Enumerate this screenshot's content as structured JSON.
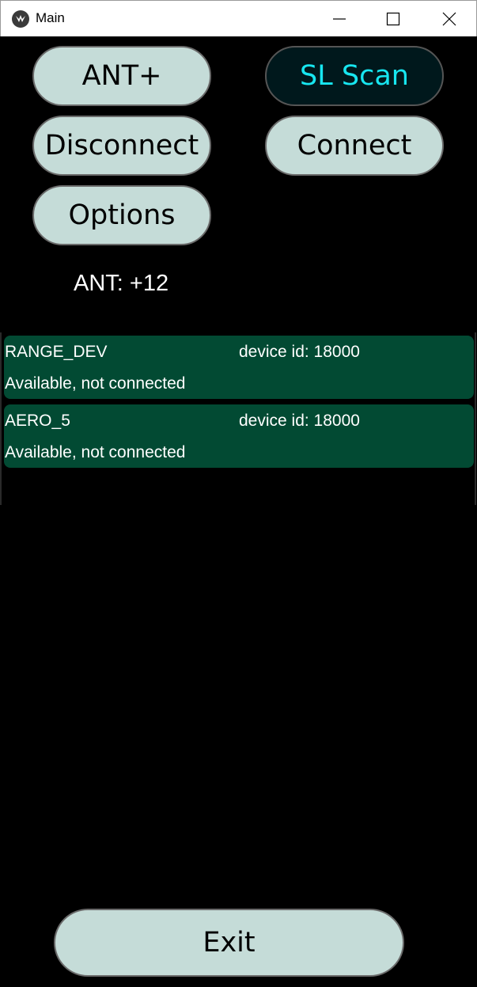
{
  "window": {
    "title": "Main",
    "controls": [
      "minimize",
      "maximize",
      "close"
    ]
  },
  "buttons": {
    "ant": "ANT+",
    "sl_scan": "SL Scan",
    "disconnect": "Disconnect",
    "connect": "Connect",
    "options": "Options",
    "exit": "Exit"
  },
  "ant_status": "ANT: +12",
  "devices": [
    {
      "name": "RANGE_DEV",
      "device_id": "device id: 18000",
      "status": "Available, not connected"
    },
    {
      "name": "AERO_5",
      "device_id": "device id: 18000",
      "status": "Available, not connected"
    }
  ],
  "colors": {
    "button_bg": "#c5dcd8",
    "active_button_bg": "#00181c",
    "active_button_text": "#17e6f0",
    "device_row_bg": "#024a33",
    "background": "#000000"
  }
}
